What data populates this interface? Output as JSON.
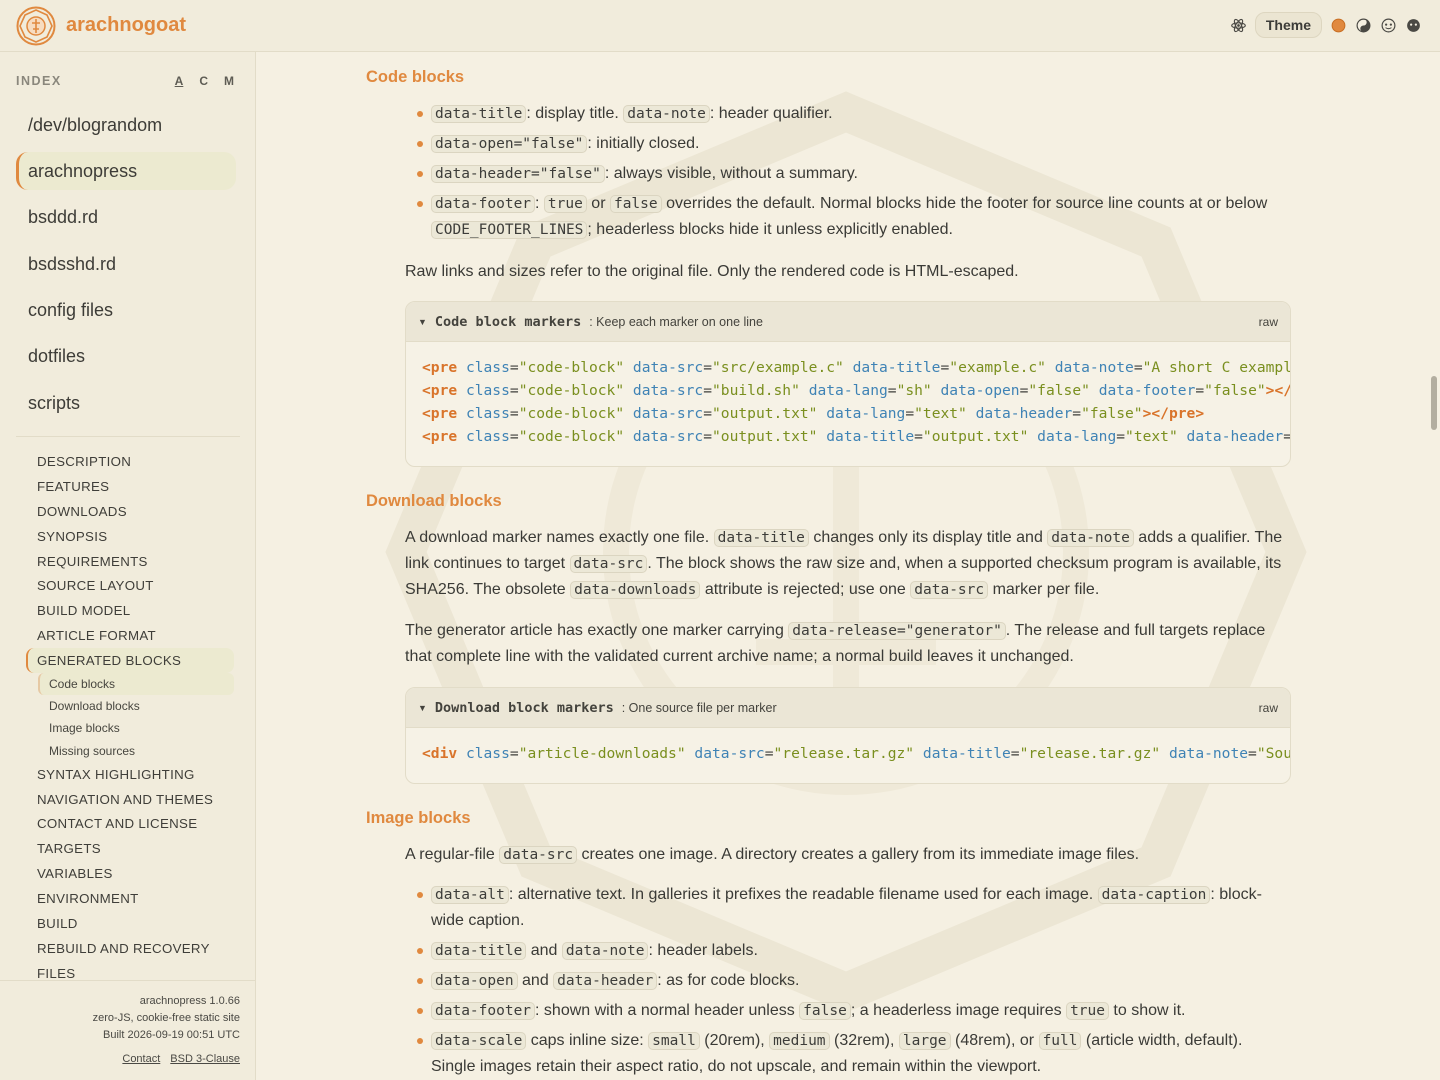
{
  "header": {
    "brand": "arachnogoat",
    "theme_label": "Theme",
    "icons": [
      "atom-icon",
      "theme-orange-dot-icon",
      "yin-yang-icon",
      "face-icon",
      "dark-face-icon"
    ],
    "accent_color": "#e0893f"
  },
  "sidebar": {
    "index_title": "INDEX",
    "sort_options": [
      "A",
      "C",
      "M"
    ],
    "projects": [
      "/dev/blograndom",
      "arachnopress",
      "bsddd.rd",
      "bsdsshd.rd",
      "config files",
      "dotfiles",
      "scripts"
    ],
    "toc_pre": [
      "DESCRIPTION",
      "FEATURES",
      "DOWNLOADS",
      "SYNOPSIS",
      "REQUIREMENTS",
      "SOURCE LAYOUT",
      "BUILD MODEL",
      "ARTICLE FORMAT",
      "GENERATED BLOCKS"
    ],
    "toc_sub": [
      "Code blocks",
      "Download blocks",
      "Image blocks",
      "Missing sources"
    ],
    "toc_post": [
      "SYNTAX HIGHLIGHTING",
      "NAVIGATION AND THEMES",
      "CONTACT AND LICENSE",
      "TARGETS",
      "VARIABLES",
      "ENVIRONMENT",
      "BUILD",
      "REBUILD AND RECOVERY",
      "FILES"
    ],
    "footer": {
      "version": "arachnopress 1.0.66",
      "tagline": "zero-JS, cookie-free static site",
      "built": "Built 2026-09-19 00:51 UTC",
      "contact": "Contact",
      "license": "BSD 3-Clause"
    }
  },
  "content": {
    "code_blocks": {
      "heading": "Code blocks",
      "b1": {
        "c1": "data-title",
        "t1": ": display title. ",
        "c2": "data-note",
        "t2": ": header qualifier."
      },
      "b2": {
        "c1": "data-open=\"false\"",
        "t1": ": initially closed."
      },
      "b3": {
        "c1": "data-header=\"false\"",
        "t1": ": always visible, without a summary."
      },
      "b4": {
        "c1": "data-footer",
        "t1": ": ",
        "c2": "true",
        "t2": " or ",
        "c3": "false",
        "t3": " overrides the default. Normal blocks hide the footer for source line counts at or below ",
        "c4": "CODE_FOOTER_LINES",
        "t4": "; headerless blocks hide it unless explicitly enabled."
      },
      "para": "Raw links and sizes refer to the original file. Only the rendered code is HTML-escaped.",
      "box": {
        "title": "Code block markers",
        "note": ": Keep each marker on one line",
        "raw": "raw"
      }
    },
    "download_blocks": {
      "heading": "Download blocks",
      "p1": {
        "t1": "A download marker names exactly one file. ",
        "c1": "data-title",
        "t2": " changes only its display title and ",
        "c2": "data-note",
        "t3": " adds a qualifier. The link continues to target ",
        "c3": "data-src",
        "t4": ". The block shows the raw size and, when a supported checksum program is available, its SHA256. The obsolete ",
        "c4": "data-downloads",
        "t5": " attribute is rejected; use one ",
        "c5": "data-src",
        "t6": " marker per file."
      },
      "p2": {
        "t1": "The generator article has exactly one marker carrying ",
        "c1": "data-release=\"generator\"",
        "t2": ". The release and full targets replace that complete line with the validated current archive name; a normal build leaves it unchanged."
      },
      "box": {
        "title": "Download block markers",
        "note": ": One source file per marker",
        "raw": "raw"
      }
    },
    "image_blocks": {
      "heading": "Image blocks",
      "p1": {
        "t1": "A regular-file ",
        "c1": "data-src",
        "t2": " creates one image. A directory creates a gallery from its immediate image files."
      },
      "b1": {
        "c1": "data-alt",
        "t1": ": alternative text. In galleries it prefixes the readable filename used for each image. ",
        "c2": "data-caption",
        "t2": ": block-wide caption."
      },
      "b2": {
        "c1": "data-title",
        "t1": " and ",
        "c2": "data-note",
        "t2": ": header labels."
      },
      "b3": {
        "c1": "data-open",
        "t1": " and ",
        "c2": "data-header",
        "t2": ": as for code blocks."
      },
      "b4": {
        "c1": "data-footer",
        "t1": ": shown with a normal header unless ",
        "c2": "false",
        "t2": "; a headerless image requires ",
        "c3": "true",
        "t3": " to show it."
      },
      "b5": {
        "c1": "data-scale",
        "t1": " caps inline size: ",
        "c2": "small",
        "t2": " (20rem), ",
        "c3": "medium",
        "t3": " (32rem), ",
        "c4": "large",
        "t4": " (48rem), or ",
        "c5": "full",
        "t5": " (article width, default). Single images retain their aspect ratio, do not upscale, and remain within the viewport."
      }
    }
  }
}
